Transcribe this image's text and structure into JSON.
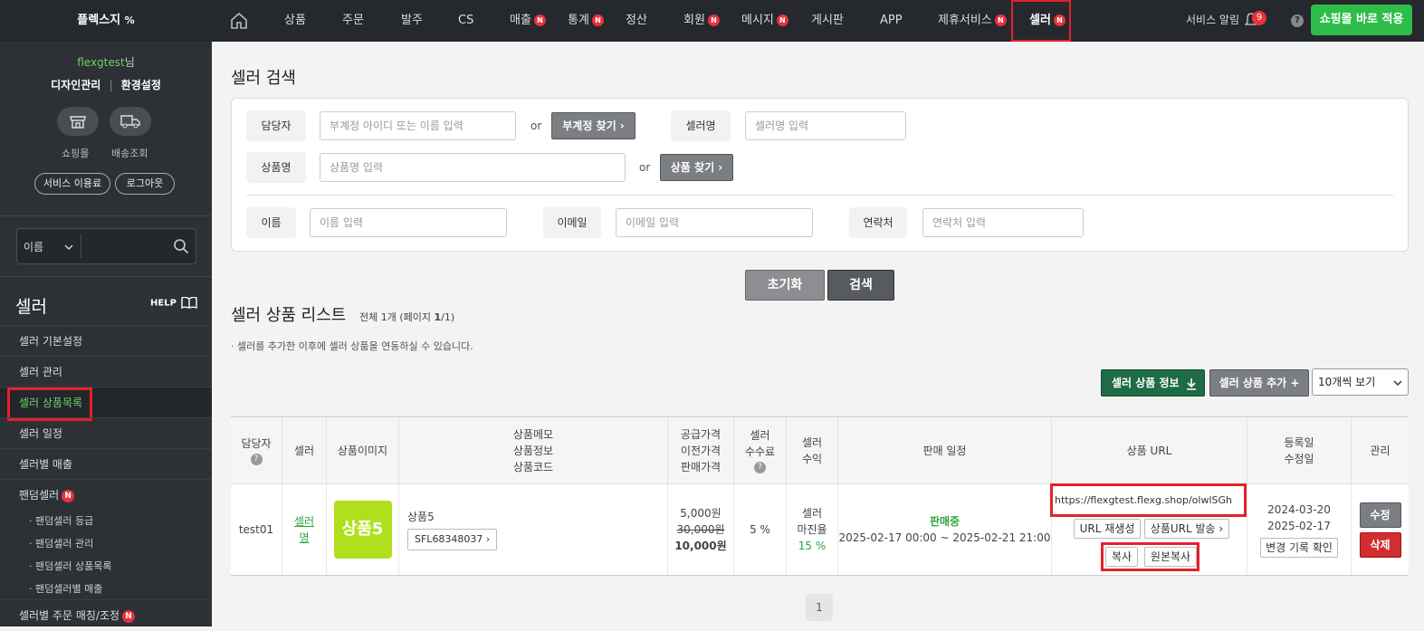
{
  "topbar": {
    "brand": "플렉스지",
    "nav": [
      {
        "label": "상품",
        "badge": ""
      },
      {
        "label": "주문",
        "badge": ""
      },
      {
        "label": "발주",
        "badge": ""
      },
      {
        "label": "CS",
        "badge": ""
      },
      {
        "label": "매출",
        "badge": "N"
      },
      {
        "label": "통계",
        "badge": "N"
      },
      {
        "label": "정산",
        "badge": ""
      },
      {
        "label": "회원",
        "badge": "N"
      },
      {
        "label": "메시지",
        "badge": "N"
      },
      {
        "label": "게시판",
        "badge": ""
      },
      {
        "label": "APP",
        "badge": ""
      },
      {
        "label": "제휴서비스",
        "badge": "N"
      },
      {
        "label": "셀러",
        "badge": "N"
      }
    ],
    "alarm_label": "서비스 알림",
    "alarm_count": "9",
    "help": "?",
    "apply_button": "쇼핑몰 바로 적용"
  },
  "sidebar": {
    "user_id": "flexgtest",
    "user_suffix": "님",
    "design_link": "디자인관리",
    "env_link": "환경설정",
    "shop_label": "쇼핑몰",
    "delivery_label": "배송조회",
    "fee_button": "서비스 이용료",
    "logout_button": "로그아웃",
    "search_select": "이름",
    "section_title": "셀러",
    "help_label": "HELP",
    "menu": [
      "셀러 기본설정",
      "셀러 관리",
      "셀러 상품목록",
      "셀러 일정",
      "셀러별 매출",
      "팬덤셀러"
    ],
    "fandom_badge": "N",
    "submenu": [
      "· 팬덤셀러 등급",
      "· 팬덤셀러 관리",
      "· 팬덤셀러 상품목록",
      "· 팬덤셀러별 매출"
    ],
    "last_menu": "셀러별 주문 매칭/조정",
    "last_badge": "N"
  },
  "search": {
    "title": "셀러 검색",
    "manager_label": "담당자",
    "manager_placeholder": "부계정 아이디 또는 이름 입력",
    "or": "or",
    "find_sub_button": "부계정 찾기 ›",
    "seller_name_label": "셀러명",
    "seller_name_placeholder": "셀러명 입력",
    "product_label": "상품명",
    "product_placeholder": "상품명 입력",
    "find_product_button": "상품 찾기 ›",
    "name_label": "이름",
    "name_placeholder": "이름 입력",
    "email_label": "이메일",
    "email_placeholder": "이메일 입력",
    "phone_label": "연락처",
    "phone_placeholder": "연락처 입력",
    "reset_button": "초기화",
    "search_button": "검색"
  },
  "list": {
    "title": "셀러 상품 리스트",
    "summary_prefix": "전체 1개 (페이지 ",
    "summary_page": "1",
    "summary_suffix": "/1)",
    "note": "· 셀러를 추가한 이후에 셀러 상품을 연동하실 수 있습니다.",
    "info_button": "셀러 상품 정보",
    "add_button": "셀러 상품 추가 +",
    "per_page": "10개씩 보기",
    "headers": {
      "manager": "담당자",
      "seller": "셀러",
      "image": "상품이미지",
      "memo": [
        "상품메모",
        "상품정보",
        "상품코드"
      ],
      "price": [
        "공급가격",
        "이전가격",
        "판매가격"
      ],
      "fee": [
        "셀러",
        "수수료"
      ],
      "profit": [
        "셀러",
        "수익"
      ],
      "schedule": "판매 일정",
      "url": "상품 URL",
      "date": [
        "등록일",
        "수정일"
      ],
      "manage": "관리"
    },
    "row": {
      "manager": "test01",
      "seller": "셀러명",
      "image_text": "상품5",
      "product_name": "상품5",
      "product_code": "SFL68348037 ›",
      "supply_price": "5,000원",
      "prev_price": "30,000원",
      "sale_price": "10,000원",
      "fee": "5 %",
      "profit_label": [
        "셀러",
        "마진율"
      ],
      "margin": "15 %",
      "status": "판매중",
      "schedule": "2025-02-17 00:00 ~ 2025-02-21 21:00",
      "url": "https://flexgtest.flexg.shop/olwlSGh",
      "regen_button": "URL 재생성",
      "send_button": "상품URL 발송 ›",
      "copy_button": "복사",
      "copy_orig_button": "원본복사",
      "reg_date": "2024-03-20",
      "mod_date": "2025-02-17",
      "history_button": "변경 기록 확인",
      "edit_button": "수정",
      "delete_button": "삭제"
    },
    "page": "1"
  },
  "colors": {
    "accent_green": "#2fbd4a",
    "badge_red": "#e8323c",
    "highlight": "#e4212d",
    "dark_green": "#1e6b46"
  }
}
